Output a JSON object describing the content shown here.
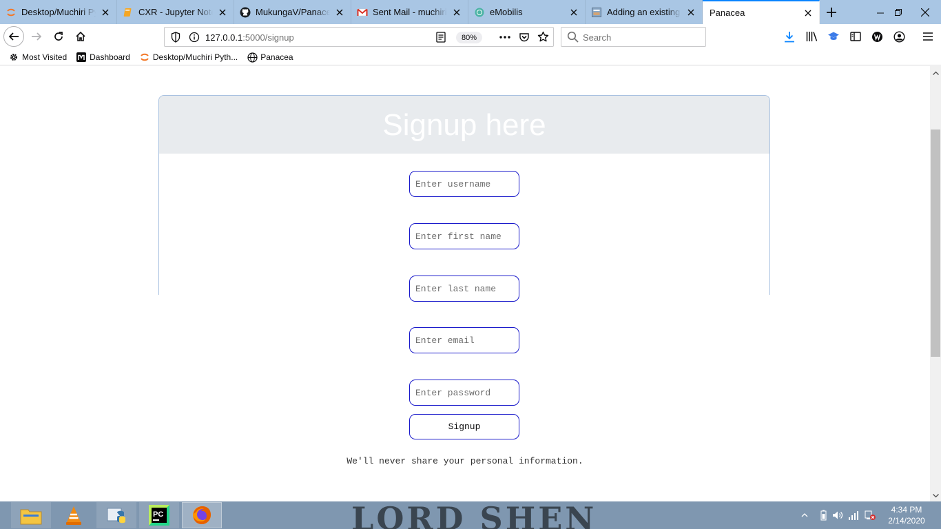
{
  "browser": {
    "tabs": [
      {
        "title": "Desktop/Muchiri Pyt",
        "icon": "jupyter-icon"
      },
      {
        "title": "CXR - Jupyter Noteb",
        "icon": "notebook-icon"
      },
      {
        "title": "MukungaV/Panacea",
        "icon": "github-icon"
      },
      {
        "title": "Sent Mail - muchiriv",
        "icon": "gmail-icon"
      },
      {
        "title": "eMobilis",
        "icon": "globe-icon"
      },
      {
        "title": "Adding an existing p",
        "icon": "page-icon"
      },
      {
        "title": "Panacea",
        "icon": "none",
        "selected": true
      }
    ],
    "url_host": "127.0.0.1",
    "url_path": ":5000/signup",
    "zoom": "80%",
    "search_placeholder": "Search",
    "bookmarks": [
      {
        "label": "Most Visited",
        "icon": "gear-icon"
      },
      {
        "label": "Dashboard",
        "icon": "m-logo-icon"
      },
      {
        "label": "Desktop/Muchiri Pyth...",
        "icon": "jupyter-icon"
      },
      {
        "label": "Panacea",
        "icon": "globe-icon"
      }
    ]
  },
  "page": {
    "heading": "Signup here",
    "fields": {
      "username_placeholder": "Enter username",
      "first_name_placeholder": "Enter first name",
      "last_name_placeholder": "Enter last name",
      "email_placeholder": "Enter email",
      "password_placeholder": "Enter password"
    },
    "submit_label": "Signup",
    "privacy_note": "We'll never share your personal information."
  },
  "taskbar": {
    "apps": [
      "file-explorer",
      "vlc",
      "python",
      "pycharm",
      "firefox"
    ],
    "wallpaper_text": "LORD SHEN",
    "time": "4:34 PM",
    "date": "2/14/2020"
  },
  "colors": {
    "tab_strip": "#a9c6e4",
    "accent": "#0a84ff",
    "field_border": "#1a1acb",
    "card_header": "#e8ebee",
    "taskbar": "#7f97b0"
  }
}
